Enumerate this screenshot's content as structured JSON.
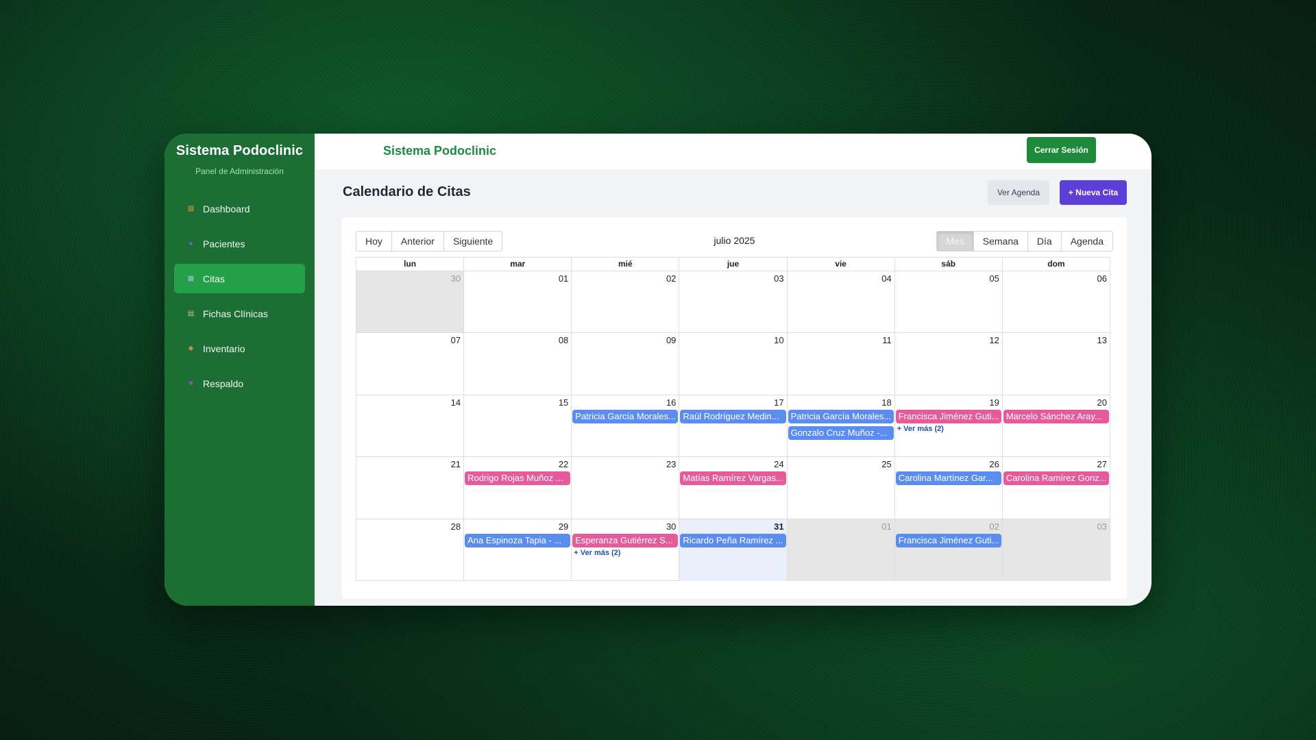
{
  "sidebar": {
    "title": "Sistema Podoclinic",
    "subtitle": "Panel de Administración",
    "items": [
      {
        "label": "Dashboard",
        "icon": "chart-icon",
        "glyph": "▥",
        "color": "#e9a23b"
      },
      {
        "label": "Pacientes",
        "icon": "users-icon",
        "glyph": "●",
        "color": "#7c5cd6"
      },
      {
        "label": "Citas",
        "icon": "calendar-icon",
        "glyph": "▦",
        "color": "#9fc1e6"
      },
      {
        "label": "Fichas Clínicas",
        "icon": "clipboard-icon",
        "glyph": "▤",
        "color": "#d9b98a"
      },
      {
        "label": "Inventario",
        "icon": "box-icon",
        "glyph": "◆",
        "color": "#c78a4a"
      },
      {
        "label": "Respaldo",
        "icon": "floppy-icon",
        "glyph": "■",
        "color": "#8e4bc4"
      }
    ],
    "active": "Citas"
  },
  "topbar": {
    "title": "Sistema Podoclinic",
    "logout_label": "Cerrar Sesión"
  },
  "page": {
    "title": "Calendario de Citas",
    "agenda_button": "Ver Agenda",
    "new_button": "+ Nueva Cita"
  },
  "calendar": {
    "nav_buttons": [
      "Hoy",
      "Anterior",
      "Siguiente"
    ],
    "month_label": "julio 2025",
    "view_buttons": [
      "Mes",
      "Semana",
      "Día",
      "Agenda"
    ],
    "active_view": "Mes",
    "weekdays": [
      "lun",
      "mar",
      "mié",
      "jue",
      "vie",
      "sáb",
      "dom"
    ],
    "weeks": [
      [
        {
          "d": "30",
          "off": true
        },
        {
          "d": "01"
        },
        {
          "d": "02"
        },
        {
          "d": "03"
        },
        {
          "d": "04"
        },
        {
          "d": "05"
        },
        {
          "d": "06"
        }
      ],
      [
        {
          "d": "07"
        },
        {
          "d": "08"
        },
        {
          "d": "09"
        },
        {
          "d": "10"
        },
        {
          "d": "11"
        },
        {
          "d": "12"
        },
        {
          "d": "13"
        }
      ],
      [
        {
          "d": "14"
        },
        {
          "d": "15"
        },
        {
          "d": "16",
          "events": [
            {
              "t": "Patricia García Morales...",
              "c": "blue"
            }
          ]
        },
        {
          "d": "17",
          "events": [
            {
              "t": "Raúl Rodríguez Medin...",
              "c": "blue"
            }
          ]
        },
        {
          "d": "18",
          "events": [
            {
              "t": "Patricia García Morales...",
              "c": "blue"
            },
            {
              "t": "Gonzalo Cruz Muñoz -...",
              "c": "blue"
            }
          ]
        },
        {
          "d": "19",
          "events": [
            {
              "t": "Francisca Jiménez Guti...",
              "c": "pink"
            }
          ],
          "more": "+ Ver más (2)"
        },
        {
          "d": "20",
          "events": [
            {
              "t": "Marcelo Sánchez Aray...",
              "c": "pink"
            }
          ]
        }
      ],
      [
        {
          "d": "21"
        },
        {
          "d": "22",
          "events": [
            {
              "t": "Rodrigo Rojas Muñoz ...",
              "c": "pink"
            }
          ]
        },
        {
          "d": "23"
        },
        {
          "d": "24",
          "events": [
            {
              "t": "Matías Ramírez Vargas...",
              "c": "pink"
            }
          ]
        },
        {
          "d": "25"
        },
        {
          "d": "26",
          "events": [
            {
              "t": "Carolina Martínez Gar...",
              "c": "blue"
            }
          ]
        },
        {
          "d": "27",
          "events": [
            {
              "t": "Carolina Ramírez Gonz...",
              "c": "pink"
            }
          ]
        }
      ],
      [
        {
          "d": "28"
        },
        {
          "d": "29",
          "events": [
            {
              "t": "Ana Espinoza Tapia - ...",
              "c": "blue"
            }
          ]
        },
        {
          "d": "30",
          "events": [
            {
              "t": "Esperanza Gutiérrez S...",
              "c": "pink"
            }
          ],
          "more": "+ Ver más (2)"
        },
        {
          "d": "31",
          "today": true,
          "events": [
            {
              "t": "Ricardo Peña Ramírez ...",
              "c": "blue"
            }
          ]
        },
        {
          "d": "01",
          "off": true
        },
        {
          "d": "02",
          "off": true,
          "events": [
            {
              "t": "Francisca Jiménez Guti...",
              "c": "blue"
            }
          ]
        },
        {
          "d": "03",
          "off": true
        }
      ]
    ]
  }
}
